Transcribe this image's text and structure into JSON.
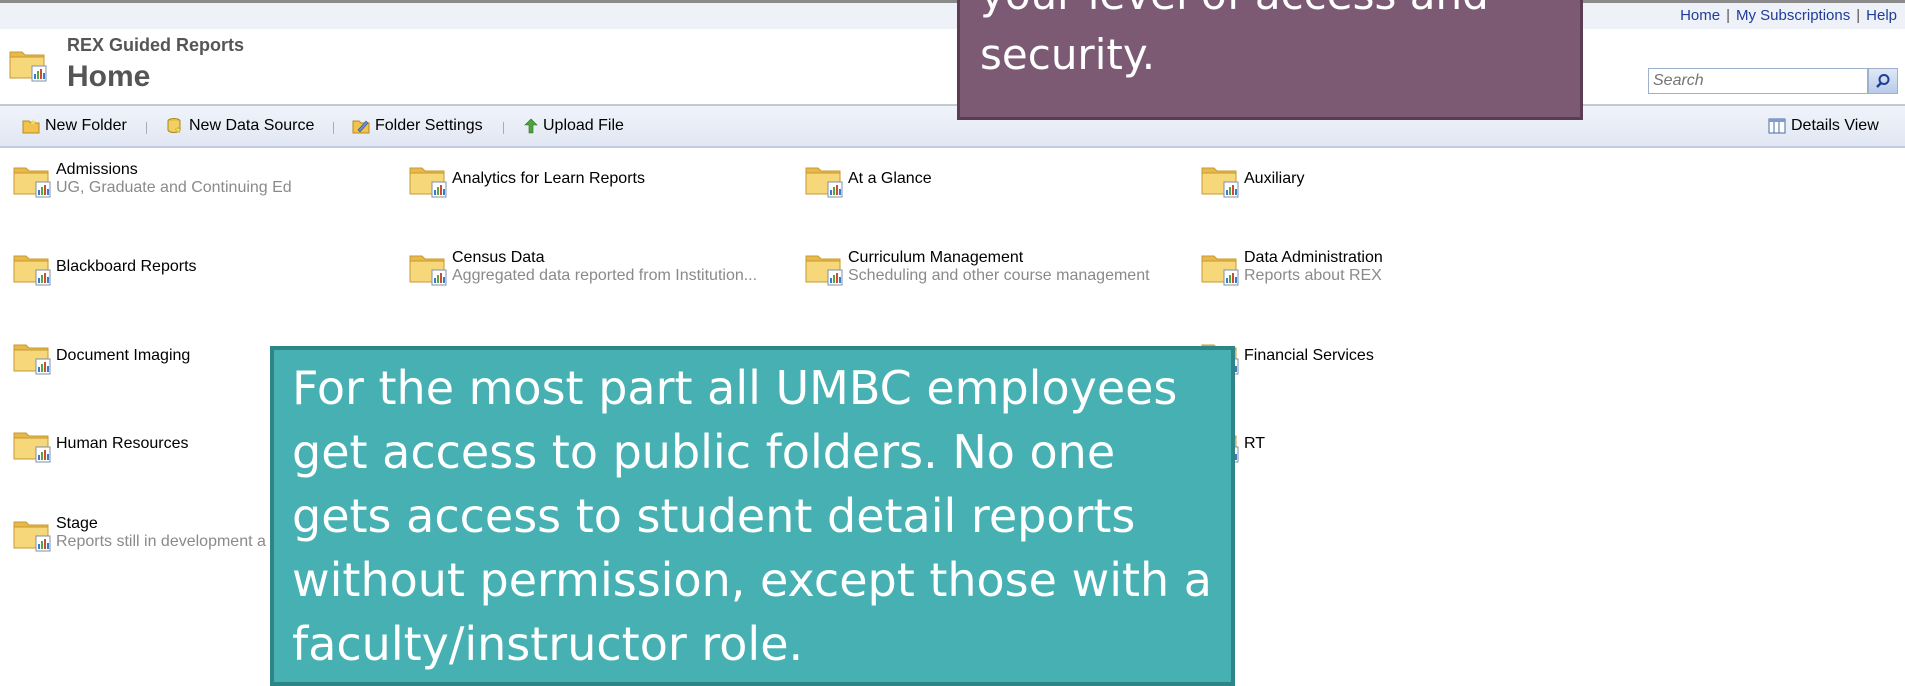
{
  "top_links": {
    "home": "Home",
    "subscriptions": "My Subscriptions",
    "help": "Help",
    "separator": "|"
  },
  "site": {
    "name": "REX Guided Reports",
    "page_title": "Home"
  },
  "search": {
    "placeholder": "Search"
  },
  "toolbar": {
    "new_folder": "New Folder",
    "new_data_source": "New Data Source",
    "folder_settings": "Folder Settings",
    "upload_file": "Upload File",
    "details_view": "Details View"
  },
  "folders": [
    {
      "name": "Admissions",
      "description": "UG, Graduate and Continuing Ed"
    },
    {
      "name": "Analytics for Learn Reports",
      "description": ""
    },
    {
      "name": "At a Glance",
      "description": ""
    },
    {
      "name": "Auxiliary",
      "description": ""
    },
    {
      "name": "Blackboard Reports",
      "description": ""
    },
    {
      "name": "Census Data",
      "description": "Aggregated data reported from Institution..."
    },
    {
      "name": "Curriculum Management",
      "description": "Scheduling and other course management"
    },
    {
      "name": "Data Administration",
      "description": "Reports about REX"
    },
    {
      "name": "Document Imaging",
      "description": ""
    },
    {
      "name": "Financial Services",
      "description": ""
    },
    {
      "name": "Human Resources",
      "description": ""
    },
    {
      "name": "RT",
      "description": ""
    },
    {
      "name": "Stage",
      "description": "Reports still in development a"
    }
  ],
  "callouts": {
    "purple_text": "your level of access and security.",
    "teal_text": "For the most part all UMBC employees get access to public folders.  No one gets access to student detail reports without permission, except those with a faculty/instructor role."
  },
  "colors": {
    "callout_purple": "#7d5a74",
    "callout_teal": "#46b0b3",
    "link_blue": "#1f3d99",
    "folder_yellow": "#f1cf6a"
  }
}
